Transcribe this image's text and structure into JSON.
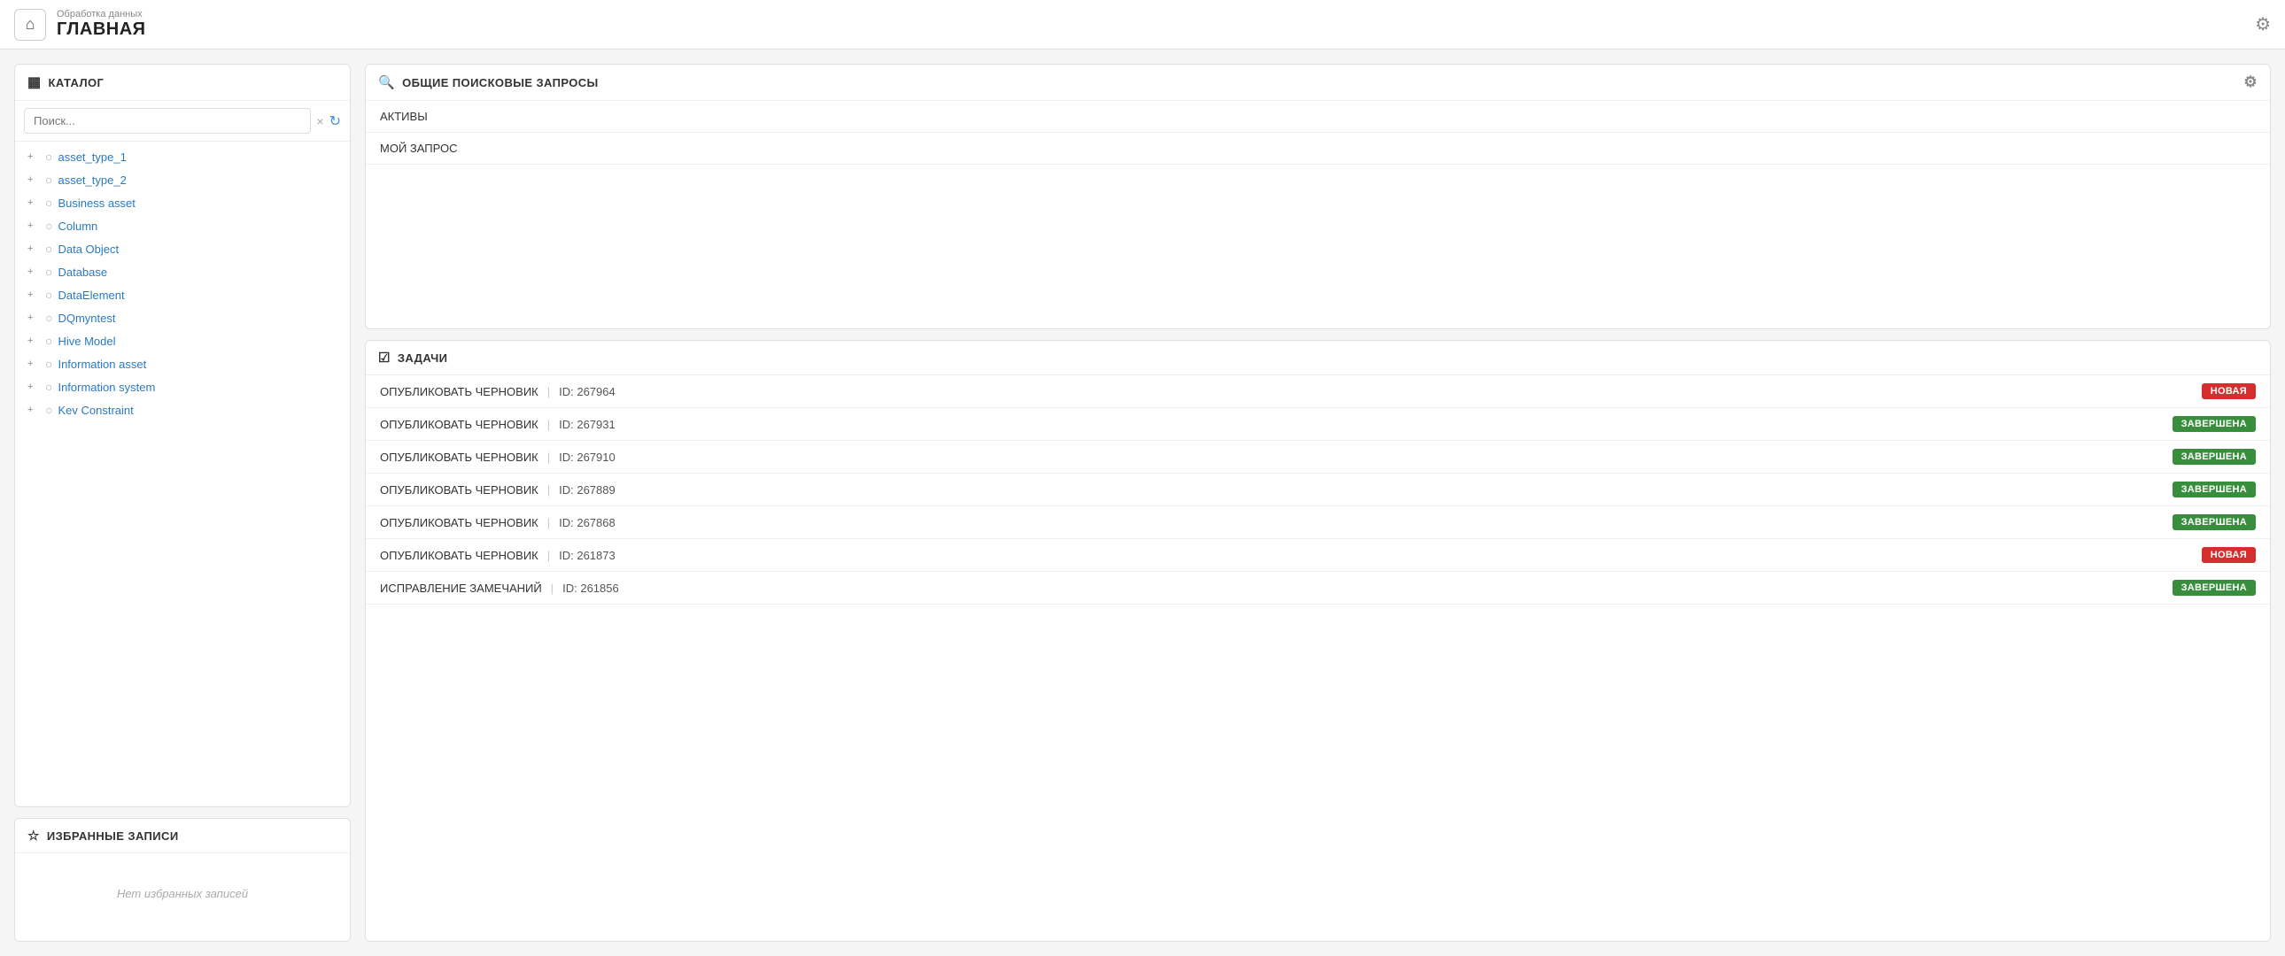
{
  "header": {
    "subtitle": "Обработка данных",
    "title": "ГЛАВНАЯ",
    "home_icon": "⌂",
    "gear_icon": "⚙"
  },
  "catalog": {
    "title": "КАТАЛОГ",
    "search_placeholder": "Поиск...",
    "items": [
      {
        "label": "asset_type_1"
      },
      {
        "label": "asset_type_2"
      },
      {
        "label": "Business asset"
      },
      {
        "label": "Column"
      },
      {
        "label": "Data Object"
      },
      {
        "label": "Database"
      },
      {
        "label": "DataElement"
      },
      {
        "label": "DQmyntest"
      },
      {
        "label": "Hive Model"
      },
      {
        "label": "Information asset"
      },
      {
        "label": "Information system"
      },
      {
        "label": "Kev Constraint"
      }
    ]
  },
  "favorites": {
    "title": "ИЗБРАННЫЕ ЗАПИСИ",
    "empty_text": "Нет избранных записей"
  },
  "queries": {
    "title": "ОБЩИЕ ПОИСКОВЫЕ ЗАПРОСЫ",
    "items": [
      {
        "label": "АКТИВЫ"
      },
      {
        "label": "МОЙ ЗАПРОС"
      }
    ]
  },
  "tasks": {
    "title": "ЗАДАЧИ",
    "rows": [
      {
        "action": "ОПУБЛИКОВАТЬ ЧЕРНОВИК",
        "id": "ID: 267964",
        "status": "НОВАЯ",
        "badge_type": "new"
      },
      {
        "action": "ОПУБЛИКОВАТЬ ЧЕРНОВИК",
        "id": "ID: 267931",
        "status": "ЗАВЕРШЕНА",
        "badge_type": "done"
      },
      {
        "action": "ОПУБЛИКОВАТЬ ЧЕРНОВИК",
        "id": "ID: 267910",
        "status": "ЗАВЕРШЕНА",
        "badge_type": "done"
      },
      {
        "action": "ОПУБЛИКОВАТЬ ЧЕРНОВИК",
        "id": "ID: 267889",
        "status": "ЗАВЕРШЕНА",
        "badge_type": "done"
      },
      {
        "action": "ОПУБЛИКОВАТЬ ЧЕРНОВИК",
        "id": "ID: 267868",
        "status": "ЗАВЕРШЕНА",
        "badge_type": "done"
      },
      {
        "action": "ОПУБЛИКОВАТЬ ЧЕРНОВИК",
        "id": "ID: 261873",
        "status": "НОВАЯ",
        "badge_type": "new"
      },
      {
        "action": "ИСПРАВЛЕНИЕ ЗАМЕЧАНИЙ",
        "id": "ID: 261856",
        "status": "ЗАВЕРШЕНА",
        "badge_type": "done"
      }
    ]
  },
  "icons": {
    "catalog": "▦",
    "favorites": "☆",
    "search": "🔍",
    "tasks": "☑",
    "gear": "⚙",
    "folder": "○",
    "plus": "+",
    "clear": "×",
    "refresh": "↻"
  }
}
